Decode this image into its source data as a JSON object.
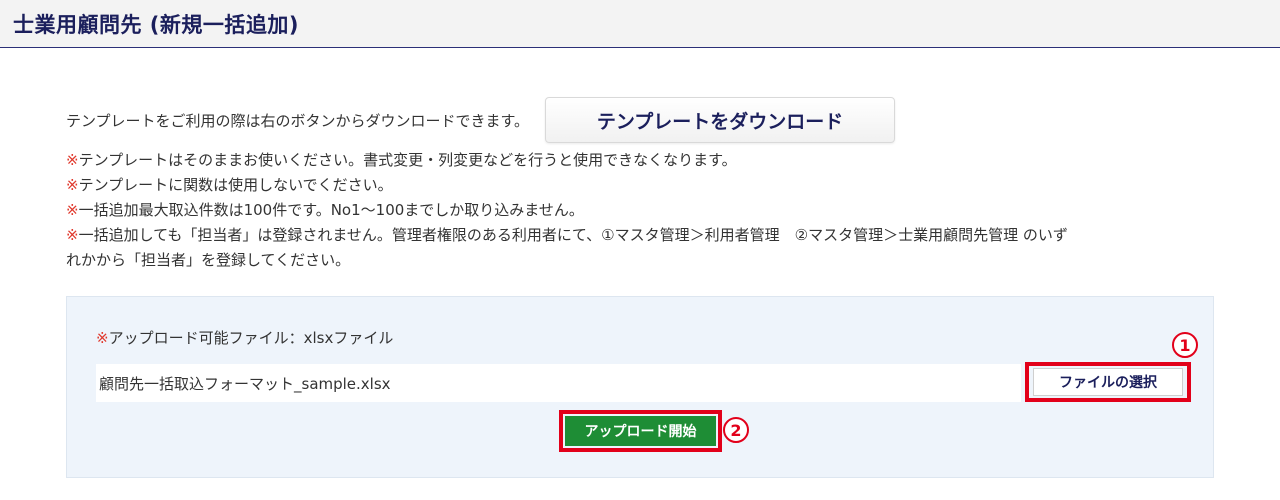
{
  "page": {
    "title": "士業用顧問先 (新規一括追加)"
  },
  "template": {
    "intro_text": "テンプレートをご利用の際は右のボタンからダウンロードできます。",
    "download_button_label": "テンプレートをダウンロード"
  },
  "notes": {
    "marker": "※",
    "lines": [
      "テンプレートはそのままお使いください。書式変更・列変更などを行うと使用できなくなります。",
      "テンプレートに関数は使用しないでください。",
      "一括追加最大取込件数は100件です。No1～100までしか取り込みません。",
      "一括追加しても「担当者」は登録されません。管理者権限のある利用者にて、①マスタ管理＞利用者管理　②マスタ管理＞士業用顧問先管理 のいずれかから「担当者」を登録してください。"
    ],
    "note4_part1": "一括追加しても「担当者」は登録されません。管理者権限のある利用者にて、①マスタ管理＞利用者管理　②マスタ管理＞士業用顧問先管理 のいず",
    "note4_part2": "れかから「担当者」を登録してください。"
  },
  "upload": {
    "allowed_marker": "※",
    "allowed_text": "アップロード可能ファイル：xlsxファイル",
    "file_value": "顧問先一括取込フォーマット_sample.xlsx",
    "choose_button_label": "ファイルの選択",
    "start_button_label": "アップロード開始",
    "step1_badge": "1",
    "step2_badge": "2"
  },
  "colors": {
    "header_navy": "#1b1f5c",
    "note_mark_red": "#e0392d",
    "highlight_red": "#e2001a",
    "upload_green": "#1e8d35",
    "panel_bg": "#eef4fb"
  }
}
